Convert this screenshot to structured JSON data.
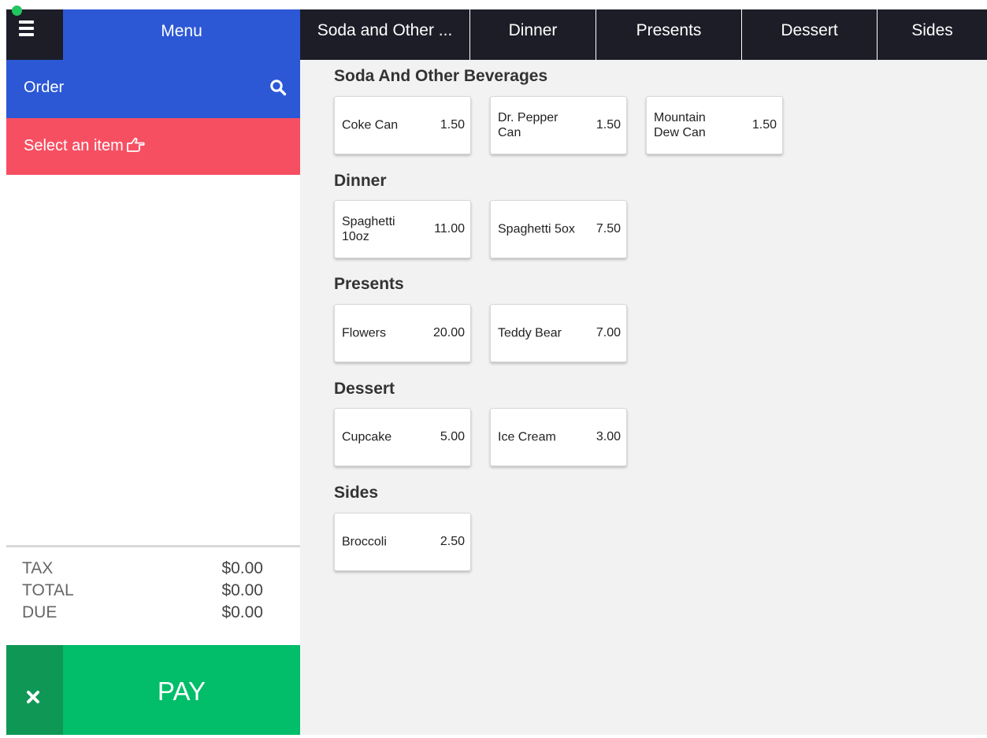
{
  "header": {
    "menu_title": "Menu"
  },
  "order": {
    "label": "Order",
    "select_prompt": "Select an item"
  },
  "totals": [
    {
      "label": "TAX",
      "value": "$0.00"
    },
    {
      "label": "TOTAL",
      "value": "$0.00"
    },
    {
      "label": "DUE",
      "value": "$0.00"
    }
  ],
  "actions": {
    "pay_label": "PAY"
  },
  "tabs": [
    "Soda and Other ...",
    "Dinner",
    "Presents",
    "Dessert",
    "Sides"
  ],
  "sections": [
    {
      "title": "Soda And Other Beverages",
      "items": [
        {
          "name": "Coke Can",
          "price": "1.50"
        },
        {
          "name": "Dr. Pepper Can",
          "price": "1.50"
        },
        {
          "name": "Mountain Dew Can",
          "price": "1.50"
        }
      ]
    },
    {
      "title": "Dinner",
      "items": [
        {
          "name": "Spaghetti 10oz",
          "price": "11.00"
        },
        {
          "name": "Spaghetti 5ox",
          "price": "7.50"
        }
      ]
    },
    {
      "title": "Presents",
      "items": [
        {
          "name": "Flowers",
          "price": "20.00"
        },
        {
          "name": "Teddy Bear",
          "price": "7.00"
        }
      ]
    },
    {
      "title": "Dessert",
      "items": [
        {
          "name": "Cupcake",
          "price": "5.00"
        },
        {
          "name": "Ice Cream",
          "price": "3.00"
        }
      ]
    },
    {
      "title": "Sides",
      "items": [
        {
          "name": "Broccoli",
          "price": "2.50"
        }
      ]
    }
  ],
  "colors": {
    "primary_blue": "#2c58d6",
    "dark_bar": "#1c1d27",
    "select_red": "#f74f62",
    "pay_green": "#02bd69",
    "cancel_green": "#0f9756",
    "status_green": "#22c55e"
  }
}
